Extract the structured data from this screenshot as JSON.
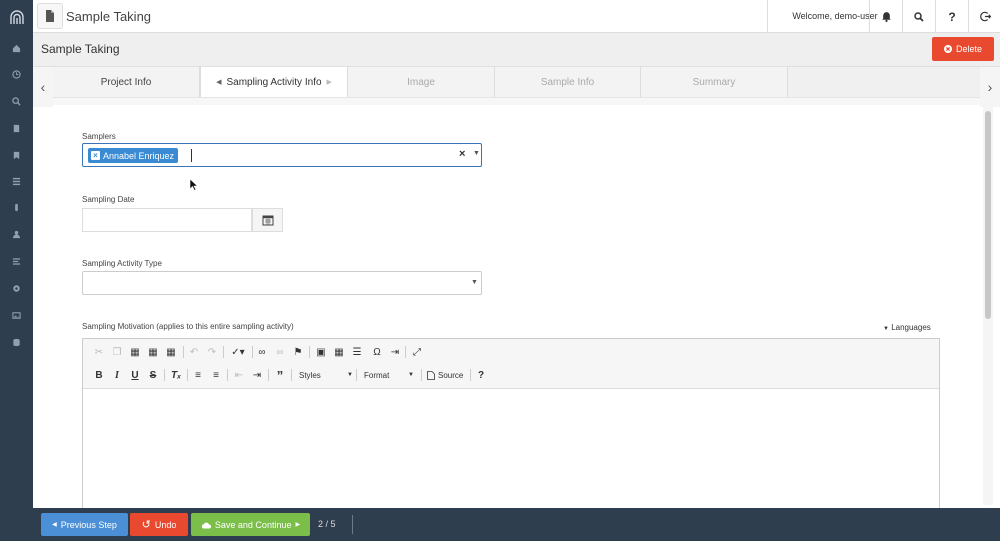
{
  "topbar": {
    "app_title": "Sample Taking",
    "welcome": "Welcome, demo-user"
  },
  "page": {
    "title": "Sample Taking",
    "delete_label": "Delete"
  },
  "tabs": [
    {
      "label": "Project Info",
      "state": "done"
    },
    {
      "label": "Sampling Activity Info",
      "state": "active"
    },
    {
      "label": "Image",
      "state": "todo"
    },
    {
      "label": "Sample Info",
      "state": "todo"
    },
    {
      "label": "Summary",
      "state": "todo"
    }
  ],
  "form": {
    "samplers_label": "Samplers",
    "samplers_chip": "Annabel Enriquez",
    "sampling_date_label": "Sampling Date",
    "sampling_date_value": "",
    "activity_type_label": "Sampling Activity Type",
    "activity_type_value": "",
    "motivation_label": "Sampling Motivation (applies to this entire sampling activity)",
    "languages_label": "Languages"
  },
  "editor": {
    "styles_label": "Styles",
    "format_label": "Format",
    "source_label": "Source"
  },
  "bottombar": {
    "previous_label": "Previous Step",
    "undo_label": "Undo",
    "save_label": "Save and Continue",
    "step_counter": "2 / 5"
  },
  "colors": {
    "sidebar_bg": "#2f3e4e",
    "delete_red": "#e8492f",
    "previous_blue": "#4b8fd6",
    "undo_red": "#e8492f",
    "save_green": "#7bbf4a",
    "chip_blue": "#3b8bd4"
  }
}
